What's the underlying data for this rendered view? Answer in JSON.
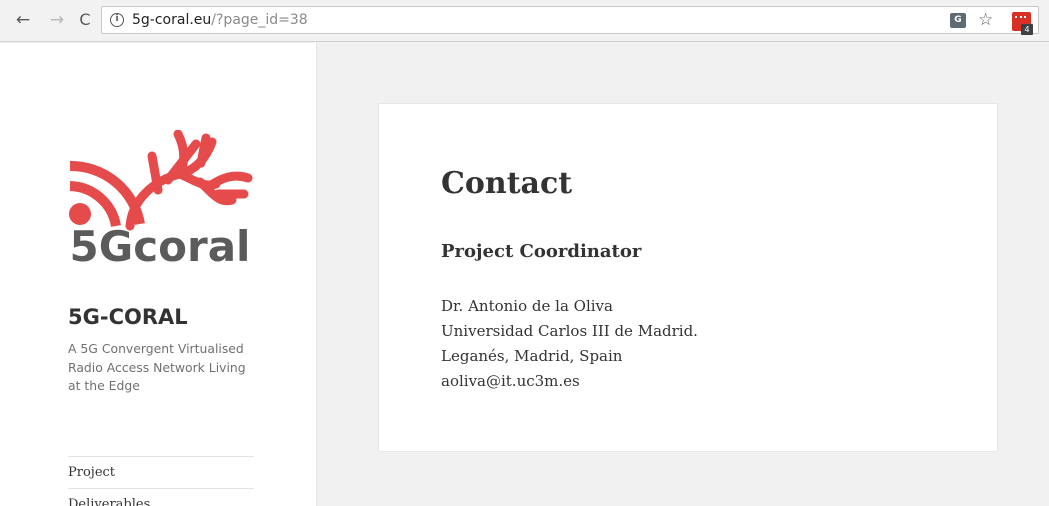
{
  "browser": {
    "url_domain": "5g-coral.eu",
    "url_path": "/?page_id=38",
    "back_icon": "←",
    "forward_icon": "→",
    "reload_icon": "C",
    "info_icon": "i",
    "translate_icon": "G",
    "star_icon": "☆",
    "extension_badge": "4"
  },
  "sidebar": {
    "logo_text": "5Gcoral",
    "site_title": "5G-CORAL",
    "site_description": "A 5G Convergent Virtualised Radio Access Network Living at the Edge",
    "menu": [
      {
        "label": "Project"
      },
      {
        "label": "Deliverables"
      }
    ]
  },
  "content": {
    "title": "Contact",
    "section_heading": "Project Coordinator",
    "contact_lines": [
      "Dr. Antonio de la Oliva",
      "Universidad Carlos III de Madrid.",
      "Leganés, Madrid, Spain",
      "aoliva@it.uc3m.es"
    ]
  },
  "colors": {
    "logo_red": "#e54b4b",
    "logo_gray": "#5b5b5b",
    "text": "#333333",
    "muted_text": "#707070"
  }
}
